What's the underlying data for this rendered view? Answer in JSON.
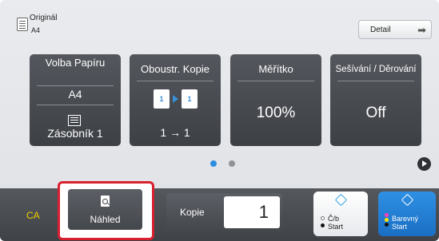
{
  "header": {
    "original_label": "Originál",
    "original_size": "A4",
    "detail_label": "Detail",
    "detail_arrow": "➡"
  },
  "tiles": [
    {
      "title": "Volba Papíru",
      "line1": "A4",
      "line2": "Zásobník 1"
    },
    {
      "title": "Oboustr. Kopie",
      "page_left": "1",
      "page_right": "1",
      "value": "1 → 1"
    },
    {
      "title": "Měřítko",
      "value": "100%"
    },
    {
      "title": "Sešívání / Děrování",
      "value": "Off"
    }
  ],
  "pager": {
    "pages": 2,
    "active_page": 1
  },
  "bottom": {
    "ca_label": "CA",
    "preview_label": "Náhled",
    "copies_label": "Kopie",
    "copies_value": "1",
    "bw_label_1": "Č/b",
    "bw_label_2": "Start",
    "color_label_1": "Barevný",
    "color_label_2": "Start"
  },
  "colors": {
    "accent_blue": "#2d8ee0",
    "highlight_red": "#d9202f",
    "ca_yellow": "#f0d000",
    "tile_dark": "#45484d"
  },
  "icons": [
    "original-document-icon",
    "detail-arrow-icon",
    "paper-tray-icon",
    "duplex-pages-icon",
    "preview-magnifier-icon",
    "next-page-icon",
    "start-diamond-icon"
  ]
}
